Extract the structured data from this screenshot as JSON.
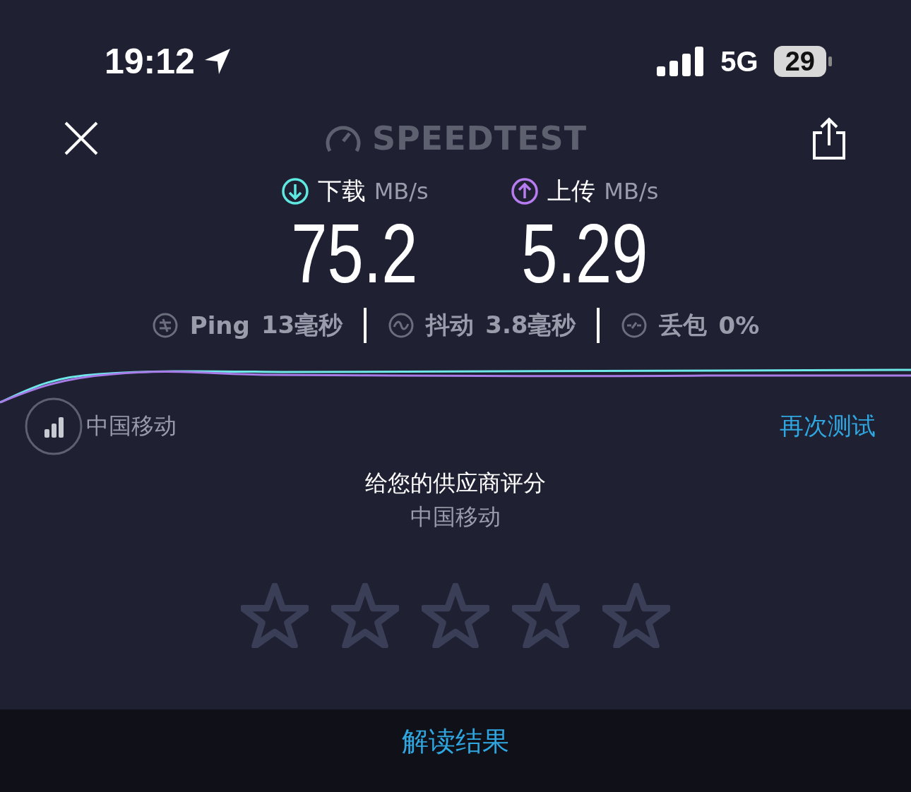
{
  "status_bar": {
    "time": "19:12",
    "network": "5G",
    "battery": "29"
  },
  "header": {
    "logo": "SPEEDTEST"
  },
  "results": [
    {
      "kind": "download",
      "label": "下载",
      "unit": "MB/s",
      "value": "75.2",
      "color": "#5ee8e0"
    },
    {
      "kind": "upload",
      "label": "上传",
      "unit": "MB/s",
      "value": "5.29",
      "color": "#b77cf0"
    }
  ],
  "metrics": [
    {
      "kind": "ping",
      "label": "Ping",
      "value": "13",
      "unit": "毫秒"
    },
    {
      "kind": "jitter",
      "label": "抖动",
      "value": "3.8",
      "unit": "毫秒"
    },
    {
      "kind": "loss",
      "label": "丢包",
      "value": "0%"
    }
  ],
  "provider": {
    "name": "中国移动",
    "retest": "再次测试"
  },
  "rating": {
    "title": "给您的供应商评分",
    "provider": "中国移动",
    "stars": 0
  },
  "footer": {
    "link": "解读结果"
  }
}
